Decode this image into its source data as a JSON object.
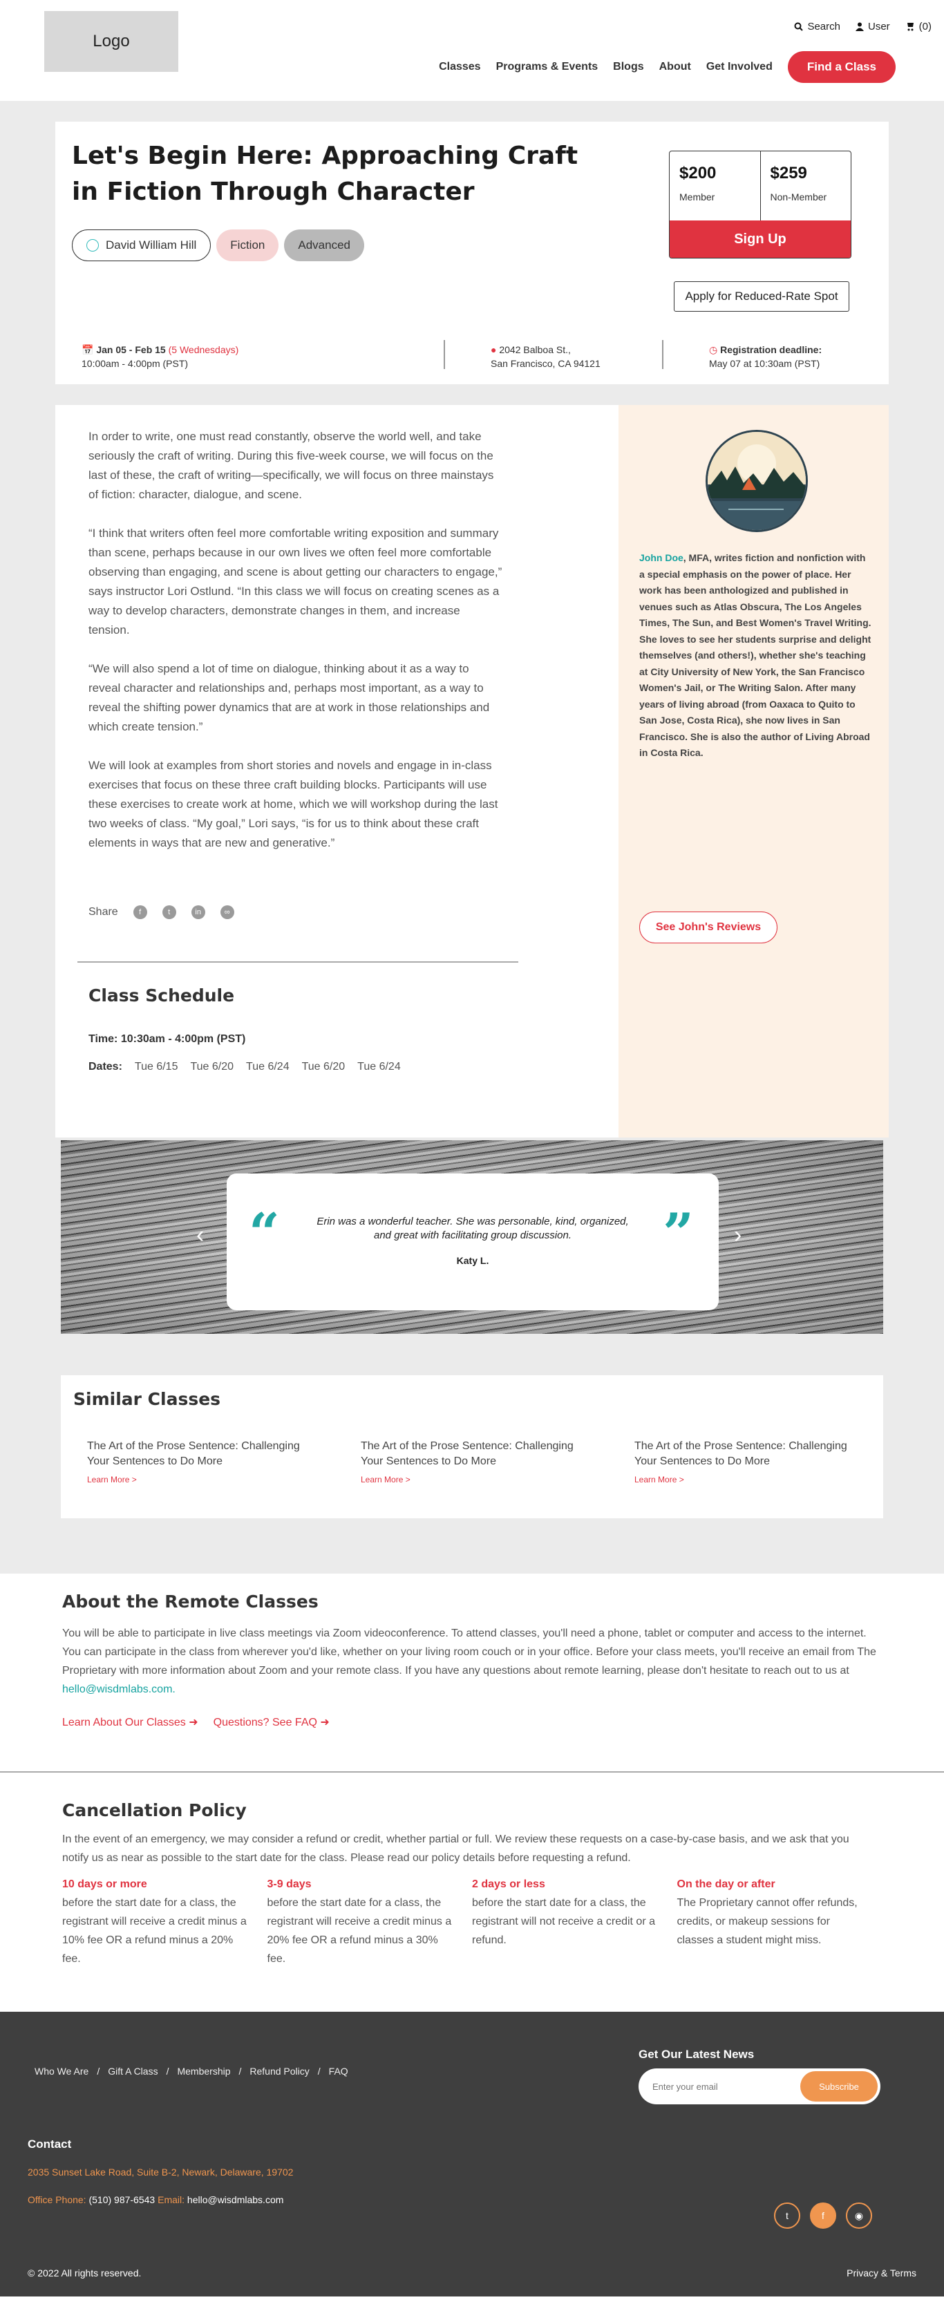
{
  "header": {
    "logo_text": "Logo",
    "search_label": "Search",
    "user_label": "User",
    "cart_count": "(0)",
    "nav": [
      "Classes",
      "Programs & Events",
      "Blogs",
      "About",
      "Get Involved"
    ],
    "find_class": "Find a Class"
  },
  "class": {
    "title": "Let's Begin Here: Approaching Craft in Fiction Through Character",
    "instructor": "David William Hill",
    "genre": "Fiction",
    "level": "Advanced",
    "member_price": "$200",
    "member_label": "Member",
    "nonmember_price": "$259",
    "nonmember_label": "Non-Member",
    "signup": "Sign Up",
    "reduced_rate": "Apply for Reduced-Rate Spot",
    "dates": "Jan 05 - Feb 15",
    "dates_note": "(5 Wednesdays)",
    "time": "10:00am - 4:00pm (PST)",
    "address1": "2042 Balboa St.,",
    "address2": "San Francisco, CA 94121",
    "deadline_label": "Registration deadline:",
    "deadline": "May 07 at 10:30am (PST)"
  },
  "description": [
    "In order to write, one must read constantly, observe the world well, and take seriously the craft of writing. During this five-week course, we will focus on the last of these, the craft of writing—specifically, we will focus on three mainstays of fiction: character, dialogue, and scene.",
    "“I think that writers often feel more comfortable writing exposition and summary than scene, perhaps because in our own lives we often feel more comfortable observing than engaging, and scene is about getting our characters to engage,” says instructor Lori Ostlund. “In this class we will focus on creating scenes as a way to develop characters, demonstrate changes in them, and increase tension.",
    "“We will also spend a lot of time on dialogue, thinking about it as a way to reveal character and relationships and, perhaps most important, as a way to reveal the shifting power dynamics that are at work in those relationships and which create tension.”",
    "We will look at examples from short stories and novels and engage in in-class exercises that focus on these three craft building blocks. Participants will use these exercises to create work at home, which we will workshop during the last two weeks of class. “My goal,” Lori says, “is for us to think about these craft elements in ways that are new and generative.”"
  ],
  "share_label": "Share",
  "schedule": {
    "title": "Class Schedule",
    "time": "Time: 10:30am - 4:00pm (PST)",
    "dates_label": "Dates:",
    "dates": [
      "Tue 6/15",
      "Tue 6/20",
      "Tue 6/24",
      "Tue 6/20",
      "Tue 6/24"
    ]
  },
  "instructor_bio": {
    "name": "John Doe",
    "text": ", MFA, writes fiction and nonfiction with a special emphasis on the power of place. Her work has been anthologized and published in venues such as Atlas Obscura, The Los Angeles Times, The Sun, and Best Women's Travel Writing. She loves to see her students surprise and delight themselves (and others!), whether she's teaching at City University of New York, the San Francisco Women's Jail, or The Writing Salon. After many years of living abroad (from Oaxaca to Quito to San Jose, Costa Rica), she now lives in San Francisco. She is also the author of Living Abroad in Costa Rica.",
    "reviews_button": "See John's Reviews"
  },
  "testimonial": {
    "quote": "Erin was a wonderful teacher. She was personable, kind, organized, and great with facilitating group discussion.",
    "author": "Katy L."
  },
  "similar": {
    "title": "Similar Classes",
    "items": [
      {
        "title": "The Art of the Prose Sentence: Challenging Your Sentences to Do More",
        "link": "Learn More >"
      },
      {
        "title": "The Art of the Prose Sentence: Challenging Your Sentences to Do More",
        "link": "Learn More >"
      },
      {
        "title": "The Art of the Prose Sentence: Challenging Your Sentences to Do More",
        "link": "Learn More >"
      }
    ]
  },
  "remote": {
    "title": "About the Remote Classes",
    "text": "You will be able to participate in live class meetings via Zoom videoconference. To attend classes, you'll need a phone, tablet or computer and access to the internet. You can participate in the class from wherever you'd like, whether on your living room couch or in your office. Before your class meets, you'll receive an email from The Proprietary with more information about Zoom and your remote class. If you have any questions about remote learning, please don't hesitate to reach out to us at",
    "email": "hello@wisdmlabs.com.",
    "link1": "Learn About Our Classes",
    "link2": "Questions? See FAQ"
  },
  "cancellation": {
    "title": "Cancellation Policy",
    "intro": "In the event of an emergency, we may consider a refund or credit, whether partial or full. We review these requests on a case-by-case basis, and we ask that you notify us as near as possible to the start date for the class. Please read our policy details before requesting a refund.",
    "tiers": [
      {
        "heading": "10 days or more",
        "text": "before the start date for a class, the registrant will receive a credit minus a 10% fee OR a refund minus a 20% fee."
      },
      {
        "heading": "3-9 days",
        "text": "before the start date for a class, the registrant will receive a credit minus a 20% fee OR a refund minus a 30% fee."
      },
      {
        "heading": "2 days or less",
        "text": "before the start date for a class, the registrant will not receive a credit or a refund."
      },
      {
        "heading": "On the day or after",
        "text": "The Proprietary cannot offer refunds, credits, or makeup sessions for classes a student might miss."
      }
    ]
  },
  "footer": {
    "links": [
      "Who We Are",
      "Gift A Class",
      "Membership",
      "Refund Policy",
      "FAQ"
    ],
    "newsletter_title": "Get Our Latest News",
    "email_placeholder": "Enter your email",
    "subscribe": "Subscribe",
    "contact_title": "Contact",
    "address": "2035 Sunset Lake Road, Suite B-2, Newark, Delaware, 19702",
    "phone_label": "Office Phone:",
    "phone": "(510) 987-6543",
    "email_label": "Email:",
    "email": "hello@wisdmlabs.com",
    "copyright": "© 2022 All rights reserved.",
    "privacy": "Privacy & Terms"
  },
  "colors": {
    "accent": "#e03340",
    "teal": "#17a3a0",
    "orange": "#f0964f",
    "footer_bg": "#3f3f3f",
    "bio_bg": "#fdf1e5"
  }
}
